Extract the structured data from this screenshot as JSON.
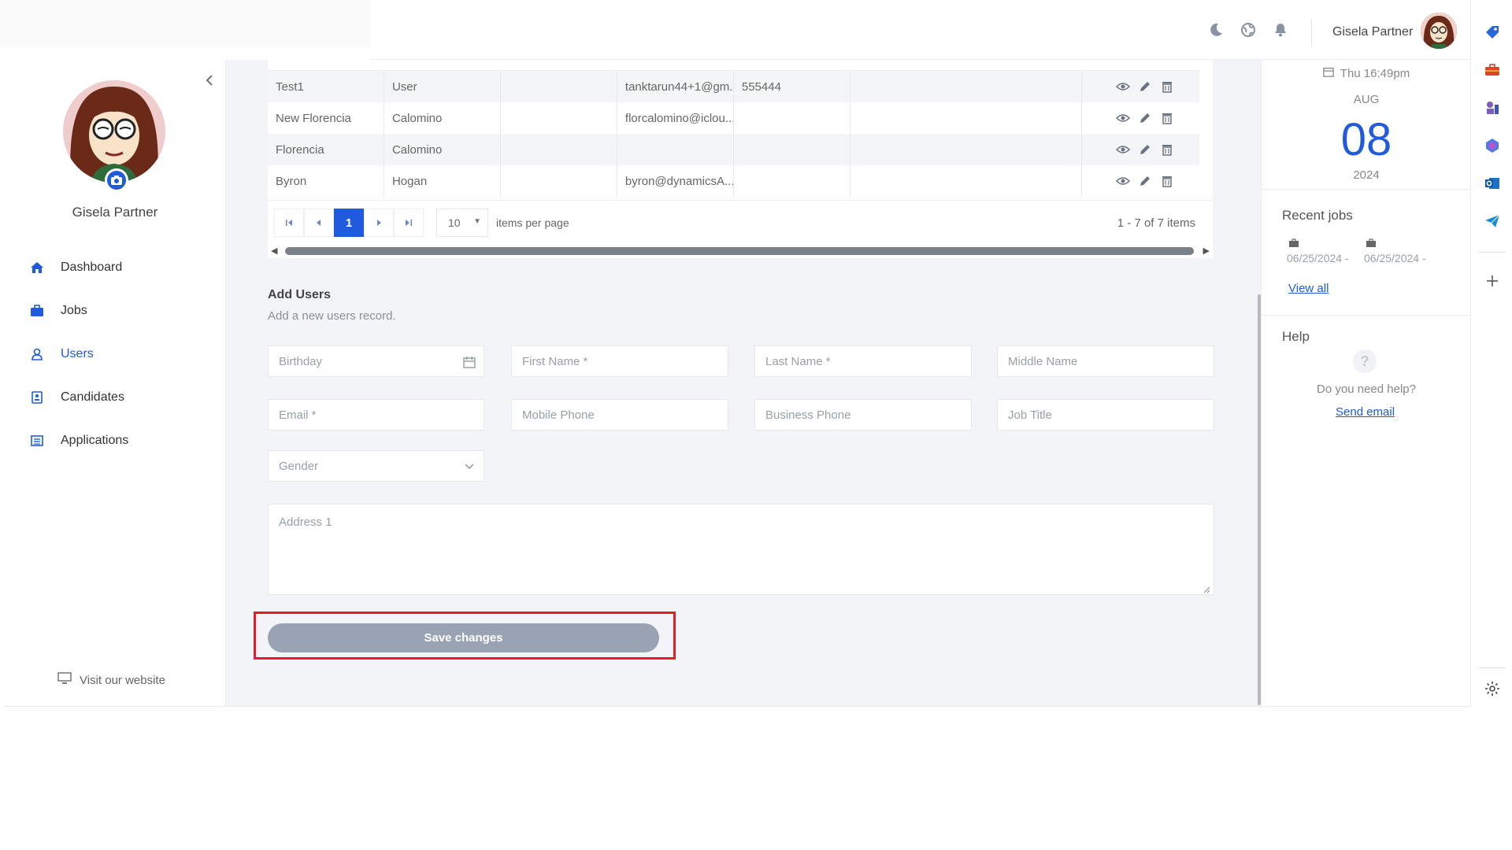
{
  "header": {
    "user_name": "Gisela Partner"
  },
  "sidebar": {
    "profile_name": "Gisela Partner",
    "items": [
      {
        "label": "Dashboard",
        "icon": "home-icon",
        "active": false
      },
      {
        "label": "Jobs",
        "icon": "briefcase-icon",
        "active": false
      },
      {
        "label": "Users",
        "icon": "user-icon",
        "active": true
      },
      {
        "label": "Candidates",
        "icon": "id-card-icon",
        "active": false
      },
      {
        "label": "Applications",
        "icon": "list-icon",
        "active": false
      }
    ],
    "visit_label": "Visit our website"
  },
  "table": {
    "rows": [
      {
        "first": "Test1",
        "last": "User",
        "middle": "",
        "email": "tanktarun44+1@gm...",
        "phone": "555444",
        "business": ""
      },
      {
        "first": "New Florencia",
        "last": "Calomino",
        "middle": "",
        "email": "florcalomino@iclou...",
        "phone": "",
        "business": ""
      },
      {
        "first": "Florencia",
        "last": "Calomino",
        "middle": "",
        "email": "",
        "phone": "",
        "business": ""
      },
      {
        "first": "Byron",
        "last": "Hogan",
        "middle": "",
        "email": "byron@dynamicsA...",
        "phone": "",
        "business": ""
      }
    ]
  },
  "pager": {
    "current_page": "1",
    "page_size": "10",
    "per_page_label": "items per page",
    "info": "1 - 7 of 7 items"
  },
  "form": {
    "title": "Add Users",
    "subtitle": "Add a new users record.",
    "birthday_ph": "Birthday",
    "first_name_ph": "First Name *",
    "last_name_ph": "Last Name *",
    "middle_name_ph": "Middle Name",
    "email_ph": "Email *",
    "mobile_ph": "Mobile Phone",
    "business_ph": "Business Phone",
    "job_title_ph": "Job Title",
    "gender_ph": "Gender",
    "address_ph": "Address 1",
    "save_label": "Save changes"
  },
  "right_panel": {
    "time": "Thu 16:49pm",
    "month": "AUG",
    "day": "08",
    "year": "2024",
    "recent_jobs_title": "Recent jobs",
    "jobs": [
      {
        "date": "06/25/2024 -"
      },
      {
        "date": "06/25/2024 -"
      }
    ],
    "view_all": "View all",
    "help_title": "Help",
    "help_q": "?",
    "help_text": "Do you need help?",
    "send_email": "Send email"
  },
  "colors": {
    "accent": "#1f5bdc",
    "highlight": "#e31d25",
    "save_button": "#9aa3b3"
  }
}
